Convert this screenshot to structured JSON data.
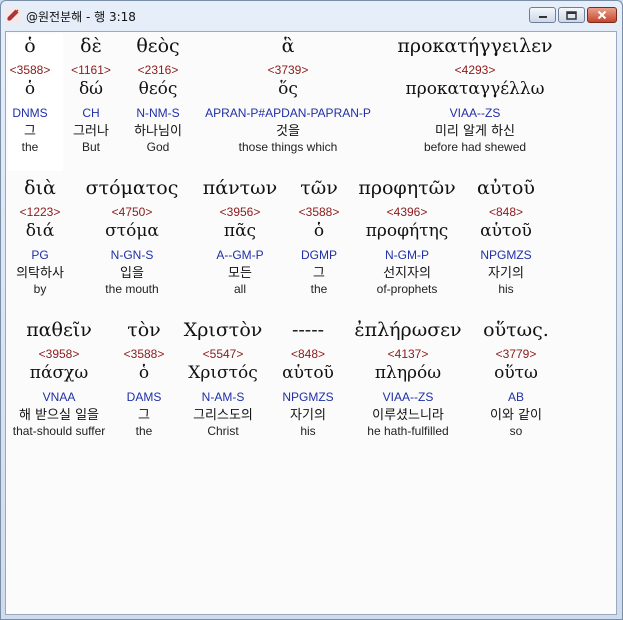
{
  "window": {
    "title": "@원전분해 - 행 3:18",
    "icon": "quill-icon"
  },
  "rows": [
    {
      "words": [
        {
          "greek": "ὁ",
          "strong": "<3588>",
          "lemma": "ὁ",
          "morph": "DNMS",
          "korean": "그",
          "english": "the"
        },
        {
          "greek": "δὲ",
          "strong": "<1161>",
          "lemma": "δώ",
          "morph": "CH",
          "korean": "그러나",
          "english": "But"
        },
        {
          "greek": "θεὸς",
          "strong": "<2316>",
          "lemma": "θεός",
          "morph": "N-NM-S",
          "korean": "하나님이",
          "english": "God"
        },
        {
          "greek": "ἃ",
          "strong": "<3739>",
          "lemma": "ὅς",
          "morph": "APRAN-P#APDAN-PAPRAN-P",
          "korean": "것을",
          "english": "those things which"
        },
        {
          "greek": "προκατήγγειλεν",
          "strong": "<4293>",
          "lemma": "προκαταγγέλλω",
          "morph": "VIAA--ZS",
          "korean": "미리 알게 하신",
          "english": "before had shewed"
        }
      ]
    },
    {
      "words": [
        {
          "greek": "διὰ",
          "strong": "<1223>",
          "lemma": "διά",
          "morph": "PG",
          "korean": "의탁하사",
          "english": "by"
        },
        {
          "greek": "στόματος",
          "strong": "<4750>",
          "lemma": "στόμα",
          "morph": "N-GN-S",
          "korean": "입을",
          "english": "the mouth"
        },
        {
          "greek": "πάντων",
          "strong": "<3956>",
          "lemma": "πᾶς",
          "morph": "A--GM-P",
          "korean": "모든",
          "english": "all"
        },
        {
          "greek": "τῶν",
          "strong": "<3588>",
          "lemma": "ὁ",
          "morph": "DGMP",
          "korean": "그",
          "english": "the"
        },
        {
          "greek": "προφητῶν",
          "strong": "<4396>",
          "lemma": "προφήτης",
          "morph": "N-GM-P",
          "korean": "선지자의",
          "english": "of-prophets"
        },
        {
          "greek": "αὐτοῦ",
          "strong": "<848>",
          "lemma": "αὑτοῦ",
          "morph": "NPGMZS",
          "korean": "자기의",
          "english": "his"
        }
      ]
    },
    {
      "words": [
        {
          "greek": "παθεῖν",
          "strong": "<3958>",
          "lemma": "πάσχω",
          "morph": "VNAA",
          "korean": "해 받으실 일을",
          "english": "that-should suffer"
        },
        {
          "greek": "τὸν",
          "strong": "<3588>",
          "lemma": "ὁ",
          "morph": "DAMS",
          "korean": "그",
          "english": "the"
        },
        {
          "greek": "Χριστὸν",
          "strong": "<5547>",
          "lemma": "Χριστός",
          "morph": "N-AM-S",
          "korean": "그리스도의",
          "english": "Christ"
        },
        {
          "greek": "-----",
          "strong": "<848>",
          "lemma": "αὑτοῦ",
          "morph": "NPGMZS",
          "korean": "자기의",
          "english": "his"
        },
        {
          "greek": "ἐπλήρωσεν",
          "strong": "<4137>",
          "lemma": "πληρόω",
          "morph": "VIAA--ZS",
          "korean": "이루셨느니라",
          "english": "he hath-fulfilled"
        },
        {
          "greek": "οὕτως.",
          "strong": "<3779>",
          "lemma": "οὕτω",
          "morph": "AB",
          "korean": "이와 같이",
          "english": "so"
        }
      ]
    }
  ]
}
